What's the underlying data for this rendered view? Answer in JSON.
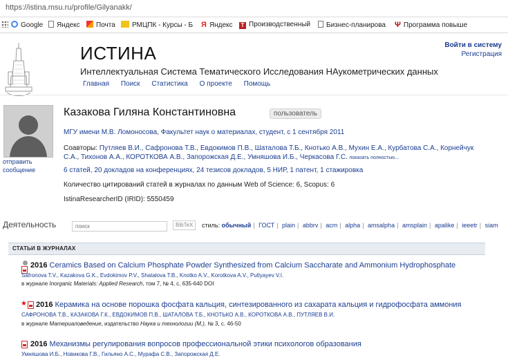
{
  "browser": {
    "url": "https://istina.msu.ru/profile/Gilyanakk/",
    "bookmarks": [
      {
        "label": "",
        "icon": "grid-icon"
      },
      {
        "label": "Google",
        "icon": "google-icon"
      },
      {
        "label": "Яндекс",
        "icon": "page-icon"
      },
      {
        "label": "Почта",
        "icon": "mail-icon"
      },
      {
        "label": "РМЦПК - Курсы - Б",
        "icon": "rmcpk-icon"
      },
      {
        "label": "Яндекс",
        "icon": "yandex-icon"
      },
      {
        "label": "Производственный",
        "icon": "t-icon"
      },
      {
        "label": "Бизнес-планирова",
        "icon": "page-icon"
      },
      {
        "label": "Программа повыше",
        "icon": "psi-icon"
      }
    ]
  },
  "header": {
    "title": "ИСТИНА",
    "subtitle": "Интеллектуальная Система Тематического Исследования НАукометрических данных",
    "nav": [
      "Главная",
      "Поиск",
      "Статистика",
      "О проекте",
      "Помощь"
    ],
    "login": "Войти в систему",
    "register": "Регистрация"
  },
  "profile": {
    "name": "Казакова Гиляна Константиновна",
    "badge": "пользователь",
    "send_message": "отправить сообщение",
    "affiliation": "МГУ имени М.В. Ломоносова, Факультет наук о материалах, студент, с 1 сентября 2011",
    "coauthors_label": "Соавторы:",
    "coauthors": "Путляев В.И., Сафронова Т.В., Евдокимов П.В., Шаталова Т.Б., Кнотько А.В., Мухин Е.А., Курбатова С.А., Корнейчук С.А., Тихонов А.А., КОРОТКОВА А.В., Запорожская Д.Е., Умняшова И.Б., Черкасова Г.С.",
    "show_all": "показать полностью...",
    "stats": "6 статей, 20 докладов на конференциях, 24 тезисов докладов, 5 НИР, 1 патент, 1 стажировка",
    "citations": "Количество цитирований статей в журналах по данным Web of Science: 6, Scopus: 6",
    "researcher_id": "IstinaResearcherID (IRID): 5550459"
  },
  "activity": {
    "title": "Деятельность",
    "search_placeholder": "поиск",
    "bibtex": "BibTeX",
    "style_label": "стиль:",
    "styles": [
      "обычный",
      "ГОСТ",
      "plain",
      "abbrv",
      "acm",
      "alpha",
      "amsalpha",
      "amsplain",
      "apalike",
      "ieeetr",
      "siam"
    ],
    "active_style": "обычный"
  },
  "section": {
    "title": "СТАТЬИ В ЖУРНАЛАХ"
  },
  "publications": [
    {
      "year": "2016",
      "title": "Ceramics Based on Calcium Phosphate Powder Synthesized from Calcium Saccharate and Ammonium Hydrophosphate",
      "authors": "Safronova T.V., Kazakova G.K., Evdokimov P.V., Shatalova T.B., Knotko A.V., Korotkova A.V., Putlyayev V.I.",
      "source_prefix": "в журнале",
      "journal": "Inorganic Materials: Applied Research",
      "source_suffix": ", том 7, № 4, с. 635-640 DOI"
    },
    {
      "year": "2016",
      "title": "Керамика на основе порошка фосфата кальция, синтезированного из сахарата кальция и гидрофосфата аммония",
      "authors": "САФРОНОВА Т.В., КАЗАКОВА Г.К., ЕВДОКИМОВ П.В., ШАТАЛОВА Т.Б., КНОТЬКО А.В., КОРОТКОВА А.В., ПУТЛЯЕВ В.И.",
      "source_prefix": "в журнале",
      "journal": "Материаловедение",
      "source_mid": ", издательство ",
      "publisher": "Наука и технологии (М.)",
      "source_suffix": ", № 3, с. 46-50"
    },
    {
      "year": "2016",
      "title": "Механизмы регулирования вопросов профессиональной этики психологов образования",
      "authors": "Умняшова И.Б., Новикова Г.В., Гильяно А.С., Мурафа С.В., Запорожская Д.Е."
    }
  ]
}
